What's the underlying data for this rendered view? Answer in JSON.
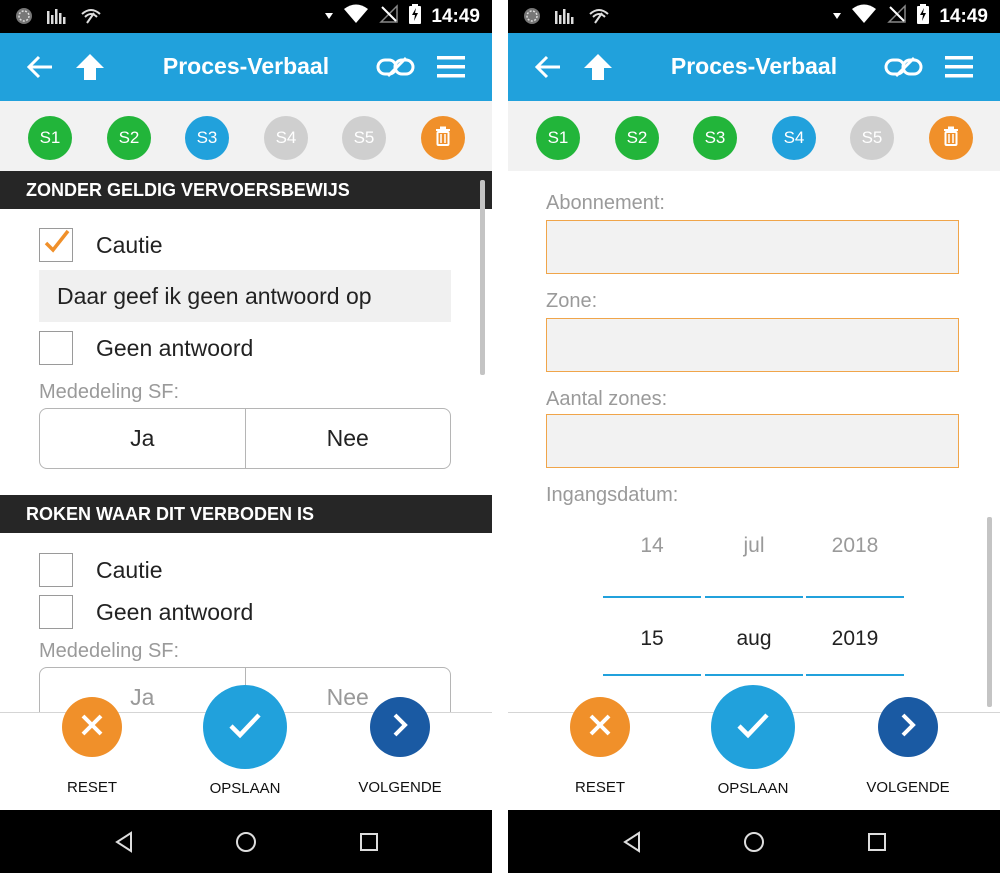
{
  "status_bar": {
    "time": "14:49"
  },
  "app_bar": {
    "title": "Proces-Verbaal"
  },
  "steps": [
    {
      "label": "S1",
      "color": "#22b53a"
    },
    {
      "label": "S2",
      "color": "#22b53a"
    },
    {
      "label": "S3",
      "color": "#21a1dc"
    },
    {
      "label": "S4",
      "color": "#cfcfcf"
    },
    {
      "label": "S5",
      "color": "#cfcfcf"
    }
  ],
  "steps_right": [
    {
      "label": "S1",
      "color": "#22b53a"
    },
    {
      "label": "S2",
      "color": "#22b53a"
    },
    {
      "label": "S3",
      "color": "#22b53a"
    },
    {
      "label": "S4",
      "color": "#21a1dc"
    },
    {
      "label": "S5",
      "color": "#cfcfcf"
    }
  ],
  "left_screen": {
    "section1": {
      "header": "ZONDER GELDIG VERVOERSBEWIJS",
      "caution_label": "Cautie",
      "caution_checked": true,
      "answer_text": "Daar geef ik geen antwoord op",
      "no_answer_label": "Geen antwoord",
      "no_answer_checked": false,
      "sf_label": "Mededeling SF:",
      "yes_label": "Ja",
      "no_label": "Nee"
    },
    "section2": {
      "header": "ROKEN WAAR DIT VERBODEN IS",
      "caution_label": "Cautie",
      "caution_checked": false,
      "no_answer_label": "Geen antwoord",
      "no_answer_checked": false,
      "sf_label": "Mededeling SF:",
      "yes_label": "Ja",
      "no_label": "Nee"
    }
  },
  "right_screen": {
    "subscription_label": "Abonnement:",
    "subscription_value": "",
    "zone_label": "Zone:",
    "zone_value": "",
    "zones_count_label": "Aantal zones:",
    "zones_count_value": "",
    "start_date_label": "Ingangsdatum:",
    "date_picker": {
      "previous": {
        "day": "14",
        "month": "jul",
        "year": "2018"
      },
      "selected": {
        "day": "15",
        "month": "aug",
        "year": "2019"
      }
    }
  },
  "actions": {
    "reset_label": "RESET",
    "save_label": "OPSLAAN",
    "next_label": "VOLGENDE"
  },
  "colors": {
    "primary": "#21a1dc",
    "reset": "#f0902a",
    "next": "#1a5aa3",
    "success": "#22b53a",
    "checkmark": "#f0902a",
    "input_border": "#f0a54a"
  }
}
